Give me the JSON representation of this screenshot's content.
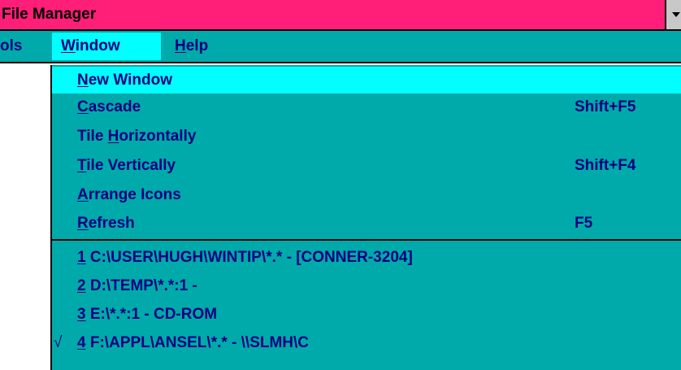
{
  "window": {
    "title": "File Manager"
  },
  "menubar": {
    "items": [
      {
        "label": "ols"
      },
      {
        "pre": "",
        "accel": "W",
        "post": "indow"
      },
      {
        "pre": "",
        "accel": "H",
        "post": "elp"
      }
    ]
  },
  "window_menu": {
    "items": [
      {
        "pre": "",
        "accel": "N",
        "post": "ew Window",
        "shortcut": ""
      },
      {
        "pre": "",
        "accel": "C",
        "post": "ascade",
        "shortcut": "Shift+F5"
      },
      {
        "pre": "Tile ",
        "accel": "H",
        "post": "orizontally",
        "shortcut": ""
      },
      {
        "pre": "",
        "accel": "T",
        "post": "ile Vertically",
        "shortcut": "Shift+F4"
      },
      {
        "pre": "",
        "accel": "A",
        "post": "rrange Icons",
        "shortcut": ""
      },
      {
        "pre": "",
        "accel": "R",
        "post": "efresh",
        "shortcut": "F5"
      }
    ],
    "open_windows": [
      {
        "num": "1",
        "path": " C:\\USER\\HUGH\\WINTIP\\*.* - [CONNER-3204]",
        "checked": ""
      },
      {
        "num": "2",
        "path": " D:\\TEMP\\*.*:1 -",
        "checked": ""
      },
      {
        "num": "3",
        "path": " E:\\*.*:1 - CD-ROM",
        "checked": ""
      },
      {
        "num": "4",
        "path": " F:\\APPL\\ANSEL\\*.* - \\\\SLMH\\C",
        "checked": "√"
      }
    ]
  },
  "colors": {
    "titlebar": "#ff1f78",
    "menu_background": "#00aaaa",
    "menu_highlight": "#00ffff",
    "menu_text": "#000080"
  }
}
